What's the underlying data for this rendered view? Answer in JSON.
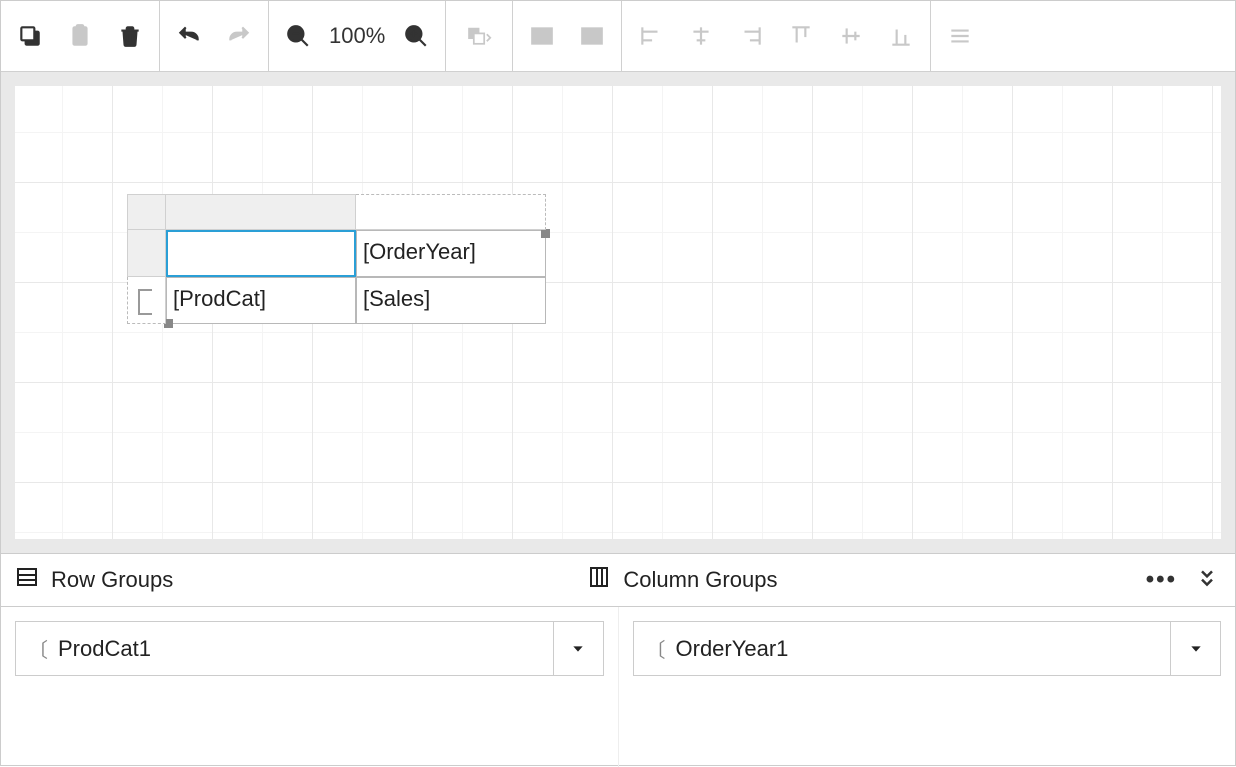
{
  "toolbar": {
    "zoom": "100%"
  },
  "matrix": {
    "corner": "",
    "column_header": "[OrderYear]",
    "row_header": "[ProdCat]",
    "data_cell": "[Sales]"
  },
  "groups": {
    "row_label": "Row Groups",
    "col_label": "Column Groups",
    "row_items": [
      "ProdCat1"
    ],
    "col_items": [
      "OrderYear1"
    ]
  }
}
